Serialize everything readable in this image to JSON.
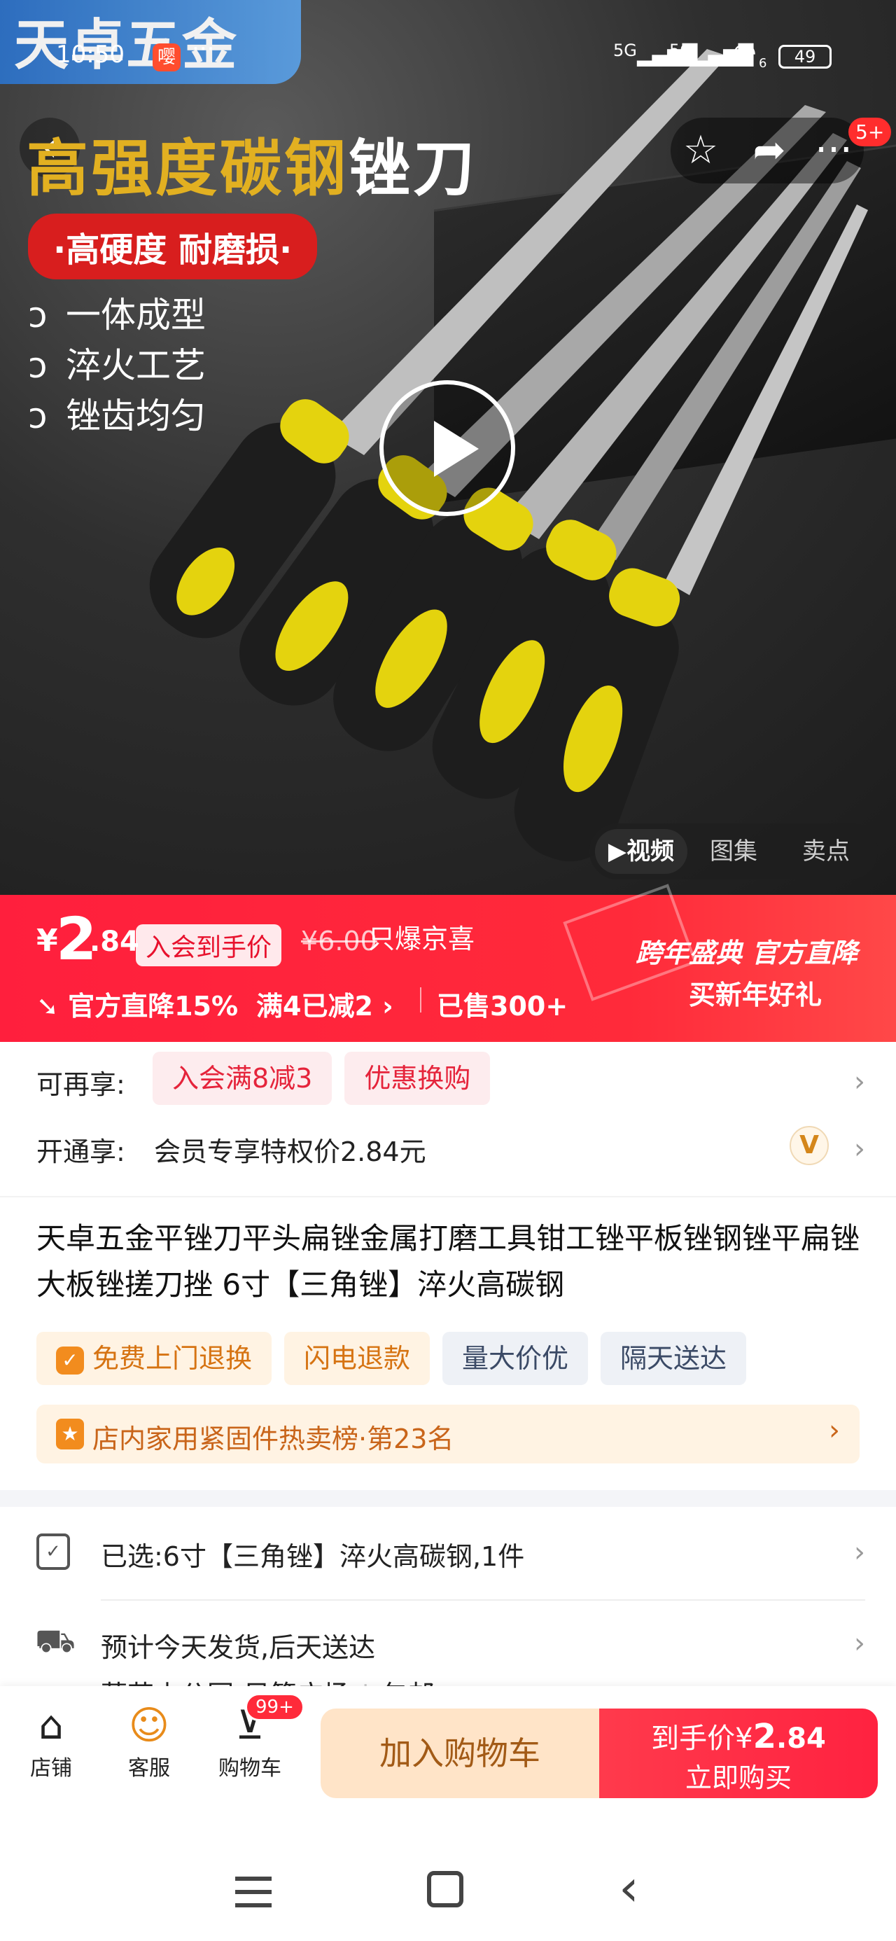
{
  "status_bar": {
    "time": "10:50",
    "app_badge": "嘤",
    "battery": "49",
    "network": "5G",
    "network2": "5G",
    "wifi_level": "6",
    "dots": "···"
  },
  "hero": {
    "brand_logo": "天卓五金",
    "headline_part1": "高强度碳钢",
    "headline_part2": "锉刀",
    "pill": "·高硬度 耐磨损·",
    "features": [
      "一体成型",
      "淬火工艺",
      "锉齿均匀"
    ],
    "cart_badge": "5+",
    "media_tabs": [
      "视频",
      "图集",
      "卖点"
    ]
  },
  "price_band": {
    "currency": "¥",
    "price_int": "2",
    "price_dec": ".84",
    "member_tag": "入会到手价",
    "old_price": "¥6.00",
    "promo_label": "只爆京喜",
    "discount": "官方直降15%",
    "bundle": "满4已减2",
    "sold": "已售300+",
    "festival": "跨年盛典 官方直降",
    "festival_sub": "买新年好礼"
  },
  "benefits": {
    "label": "可再享:",
    "chips": [
      "入会满8减3",
      "优惠换购"
    ],
    "open_label": "开通享:",
    "open_text": "会员专享特权价2.84元",
    "vip_mark": "V"
  },
  "product": {
    "title": "天卓五金平锉刀平头扁锉金属打磨工具钳工锉平板锉钢锉平扁锉大板锉搓刀挫 6寸【三角锉】淬火高碳钢",
    "tags": [
      "免费上门退换",
      "闪电退款",
      "量大价优",
      "隔天送达"
    ],
    "ranking": "店内家用紧固件热卖榜·第23名"
  },
  "selection": {
    "selected": "已选:6寸【三角锉】淬火高碳钢,1件",
    "shipping": "预计今天发货,后天送达",
    "address": "莲花山公园-风筝广场",
    "postage": "包邮"
  },
  "bottom_bar": {
    "store": "店铺",
    "service": "客服",
    "cart": "购物车",
    "cart_count": "99+",
    "add_cart": "加入购物车",
    "buy_price_label": "到手价¥",
    "buy_price_int": "2",
    "buy_price_dec": ".84",
    "buy_now": "立即购买"
  },
  "colors": {
    "accent_red": "#ff2a3a",
    "gold": "#e2b021",
    "orange_tag": "#ff8a1f"
  }
}
